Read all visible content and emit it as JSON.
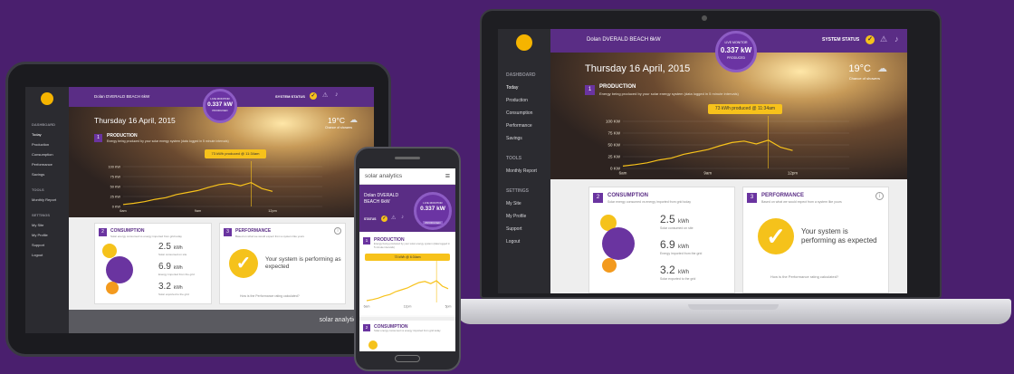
{
  "brand": {
    "logo_text": "solar analytics"
  },
  "site_name": "Dolan DVERALD BEACH 6kW",
  "site_name_phone": [
    "Dolan DVERALD",
    "BEACH 6kW"
  ],
  "system_status_label": "SYSTEM STATUS",
  "status_label_short": "STATUS",
  "live_monitor": {
    "caption": "LIVE MONITOR",
    "value": "0.337 kW",
    "sub": "PRODUCED"
  },
  "date": {
    "laptop": "Thursday 16 April, 2015",
    "tablet": "Thursday 16 April, 2015"
  },
  "weather": {
    "temp": "19°C",
    "desc": "Chance of showers"
  },
  "sidebar": {
    "dashboard": "DASHBOARD",
    "items": [
      "Today",
      "Production",
      "Consumption",
      "Performance",
      "Savings"
    ],
    "tools": "TOOLS",
    "tools_items": [
      "Monthly Report"
    ],
    "settings": "SETTINGS",
    "settings_items": [
      "My Site",
      "My Profile",
      "Support",
      "Logout"
    ]
  },
  "production": {
    "num": "1",
    "title": "PRODUCTION",
    "desc": "Energy being produced by your solar energy system (data logged in 5 minute intervals)",
    "produced": "73 kWh produced @ 11:34am",
    "produced_phone": "73 kWh @ 6:34am",
    "y_ticks": [
      "100 KW",
      "75 KW",
      "50 KW",
      "25 KW",
      "0 KW"
    ],
    "x_ticks": [
      "6am",
      "9am",
      "12pm"
    ],
    "x_ticks_phone": [
      "6am",
      "12pm",
      "5pm"
    ]
  },
  "consumption": {
    "num": "2",
    "title": "CONSUMPTION",
    "desc": "Solar energy consumed vs energy imported from grid today",
    "stats": [
      {
        "value": "2.5",
        "unit": "kWh",
        "label": "Solar consumed on site"
      },
      {
        "value": "6.9",
        "unit": "kWh",
        "label": "Energy imported from the grid"
      },
      {
        "value": "3.2",
        "unit": "kWh",
        "label": "Solar exported to the grid"
      }
    ]
  },
  "performance": {
    "num": "3",
    "title": "PERFORMANCE",
    "desc": "Based on what we would expect from a system like yours",
    "message": "Your system is performing as expected",
    "question": "How is the Performance rating calculated?"
  },
  "chart_data": {
    "type": "line",
    "title": "PRODUCTION",
    "xlabel": "",
    "ylabel": "",
    "x_categories": [
      "6am",
      "9am",
      "12pm"
    ],
    "y_tick_labels": [
      "100 KW",
      "75 KW",
      "50 KW",
      "25 KW",
      "0 KW"
    ],
    "series": [
      {
        "values": [
          5,
          8,
          12,
          18,
          22,
          30,
          35,
          40,
          48,
          55,
          58,
          52,
          60,
          45,
          38
        ]
      }
    ]
  },
  "colors": {
    "purple": "#5a2d85",
    "yellow": "#f5c21b",
    "orange": "#f39a1e",
    "background": "#4a1f6e"
  }
}
